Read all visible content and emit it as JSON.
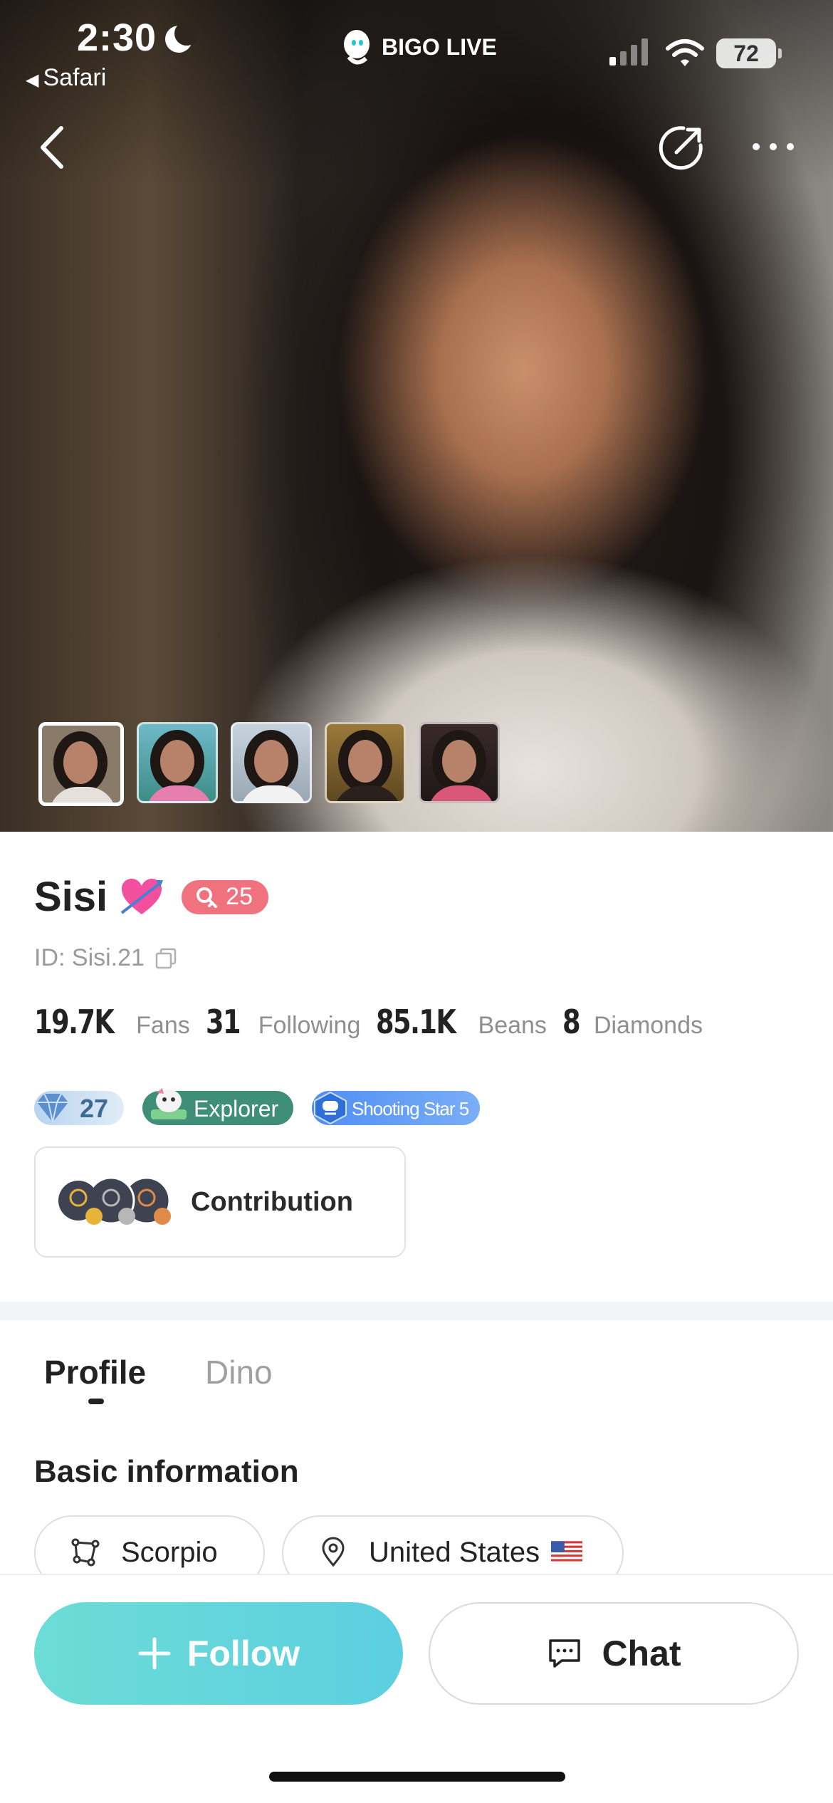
{
  "status_bar": {
    "time": "2:30",
    "back_app": "Safari",
    "battery": "72"
  },
  "brand": {
    "name": "BIGO LIVE"
  },
  "profile": {
    "name": "Sisi",
    "level": "25",
    "id_text": "ID: Sisi.21",
    "stats": [
      {
        "value": "19.7K",
        "label": "Fans"
      },
      {
        "value": "31",
        "label": "Following"
      },
      {
        "value": "85.1K",
        "label": "Beans"
      },
      {
        "value": "8",
        "label": "Diamonds"
      }
    ],
    "badges": {
      "diamond_level": "27",
      "explorer": "Explorer",
      "shooting_star": "Shooting Star 5"
    },
    "contribution": "Contribution"
  },
  "tabs": [
    {
      "label": "Profile",
      "active": true
    },
    {
      "label": "Dino",
      "active": false
    }
  ],
  "basic_info": {
    "title": "Basic information",
    "zodiac": "Scorpio",
    "country": "United States"
  },
  "actions": {
    "follow": "Follow",
    "chat": "Chat"
  },
  "icons": [
    "back-arrow-icon",
    "share-icon",
    "more-icon",
    "copy-icon",
    "heart-arrow-icon",
    "zodiac-icon",
    "location-pin-icon",
    "plus-icon",
    "chat-icon"
  ],
  "colors": {
    "level_badge": "#f0727e",
    "explorer_badge": "#3f8e78",
    "shooting_star_badge": "#4f8ef2",
    "follow_button": "#6cdcd6"
  }
}
